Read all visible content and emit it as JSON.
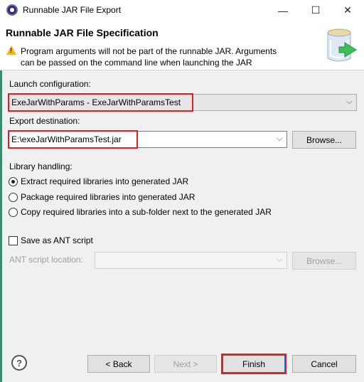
{
  "window": {
    "title": "Runnable JAR File Export",
    "minimize": "—",
    "maximize": "☐",
    "close": "✕"
  },
  "header": {
    "title": "Runnable JAR File Specification",
    "message_line1": "Program arguments will not be part of the runnable JAR. Arguments",
    "message_line2": "can be passed on the command line when launching the JAR"
  },
  "launch": {
    "label": "Launch configuration:",
    "value": "ExeJarWithParams - ExeJarWithParamsTest"
  },
  "export": {
    "label": "Export destination:",
    "value": "E:\\exeJarWithParamsTest.jar",
    "browse": "Browse..."
  },
  "library": {
    "label": "Library handling:",
    "options": [
      "Extract required libraries into generated JAR",
      "Package required libraries into generated JAR",
      "Copy required libraries into a sub-folder next to the generated JAR"
    ],
    "selected_index": 0
  },
  "ant": {
    "checkbox_label": "Save as ANT script",
    "location_label": "ANT script location:",
    "browse": "Browse..."
  },
  "footer": {
    "help": "?",
    "back": "< Back",
    "next": "Next >",
    "finish": "Finish",
    "cancel": "Cancel"
  },
  "colors": {
    "highlight": "#e02020",
    "default_button_border": "#0078d7",
    "warning": "#f2b622"
  }
}
